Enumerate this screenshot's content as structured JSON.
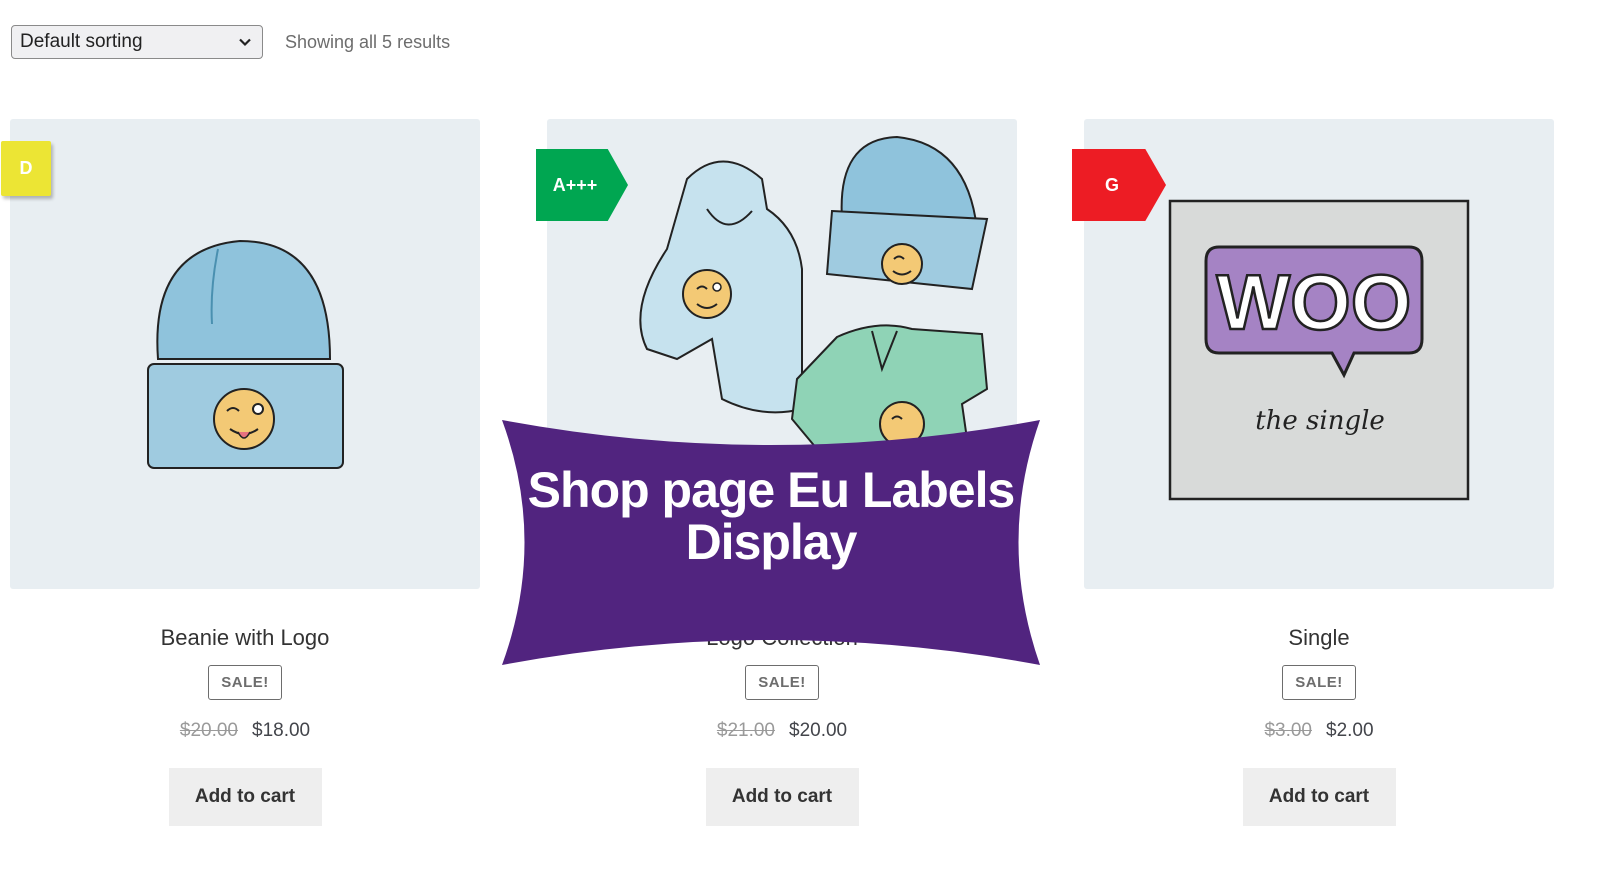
{
  "toolbar": {
    "sort_selected": "Default sorting",
    "result_count": "Showing all 5 results"
  },
  "products": [
    {
      "title": "Beanie with Logo",
      "sale_badge": "SALE!",
      "regular_price": "$20.00",
      "sale_price": "$18.00",
      "button": "Add to cart",
      "energy_label": {
        "text": "D",
        "color": "#ece534"
      },
      "image_icon": "beanie-illustration"
    },
    {
      "title": "Logo Collection",
      "sale_badge": "SALE!",
      "regular_price": "$21.00",
      "sale_price": "$20.00",
      "button": "Add to cart",
      "energy_label": {
        "text": "A+++",
        "color": "#00a651"
      },
      "image_icon": "hoodie-beanie-polo-illustration"
    },
    {
      "title": "Single",
      "sale_badge": "SALE!",
      "regular_price": "$3.00",
      "sale_price": "$2.00",
      "button": "Add to cart",
      "energy_label": {
        "text": "G",
        "color": "#ed1c24"
      },
      "image_icon": "woo-album-illustration",
      "image_text": {
        "logo": "WOO",
        "caption": "the single"
      }
    }
  ],
  "banner": {
    "text": "Shop page Eu Labels Display",
    "color": "#51247f"
  }
}
